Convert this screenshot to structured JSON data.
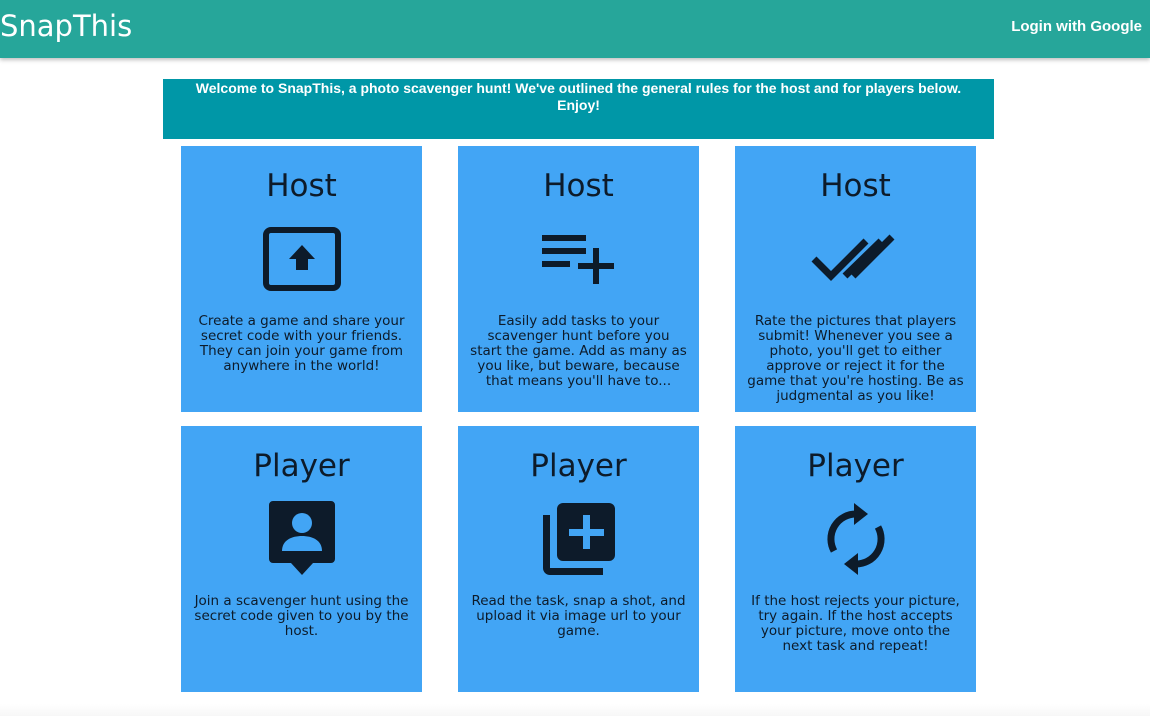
{
  "navbar": {
    "brand": "SnapThis",
    "login_label": "Login with Google",
    "color": "#26a69a"
  },
  "banner": {
    "text": "Welcome to SnapThis, a photo scavenger hunt! We've outlined the general rules for the host and for players below. Enjoy!",
    "color": "#0097a7"
  },
  "card_color": "#42a5f5",
  "cards": [
    {
      "title": "Host",
      "icon": "upload-screen-icon",
      "text": "Create a game and share your secret code with your friends. They can join your game from anywhere in the world!"
    },
    {
      "title": "Host",
      "icon": "playlist-add-icon",
      "text": "Easily add tasks to your scavenger hunt before you start the game. Add as many as you like, but beware, because that means you'll have to..."
    },
    {
      "title": "Host",
      "icon": "double-check-icon",
      "text": "Rate the pictures that players submit! Whenever you see a photo, you'll get to either approve or reject it for the game that you're hosting. Be as judgmental as you like!"
    },
    {
      "title": "Player",
      "icon": "person-pin-icon",
      "text": "Join a scavenger hunt using the secret code given to you by the host."
    },
    {
      "title": "Player",
      "icon": "library-add-icon",
      "text": "Read the task, snap a shot, and upload it via image url to your game."
    },
    {
      "title": "Player",
      "icon": "sync-icon",
      "text": "If the host rejects your picture, try again. If the host accepts your picture, move onto the next task and repeat!"
    }
  ]
}
